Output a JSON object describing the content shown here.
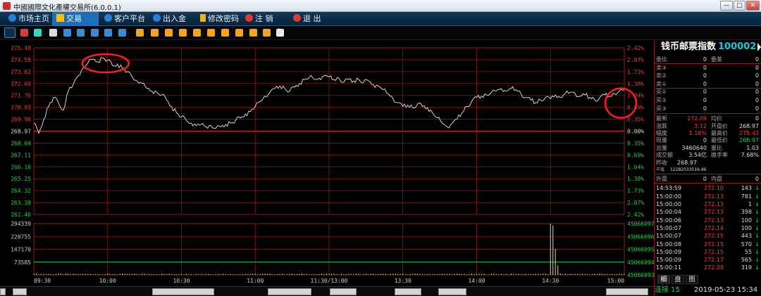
{
  "window": {
    "title": "中國國際文化產權交易所(6.0.0.1)",
    "buttons": [
      "—",
      "□",
      "✕"
    ]
  },
  "menu": [
    {
      "label": "市场主页",
      "icon": "globe-icon",
      "active": false
    },
    {
      "label": "交易",
      "icon": "chart-icon",
      "active": true
    },
    {
      "label": "客户平台",
      "icon": "globe-icon",
      "active": false
    },
    {
      "label": "出入金",
      "icon": "globe-icon",
      "active": false
    },
    {
      "label": "修改密码",
      "icon": "key-icon",
      "active": false
    },
    {
      "label": "注  销",
      "icon": "power-icon",
      "active": false
    },
    {
      "label": "退  出",
      "icon": "power-icon",
      "active": false
    }
  ],
  "toolbar": {
    "buttons": [
      "chart-bars-icon",
      "line-chart-icon",
      "tick-icon",
      "card-icon",
      "day-icon",
      "week-icon",
      "month-icon",
      "season-icon",
      "x-icon",
      "s1-icon",
      "s2-icon",
      "s3-icon",
      "s4-icon",
      "s5-icon",
      "s6-icon",
      "s7-icon",
      "s8-icon",
      "s9-icon",
      "y-icon",
      "pen-icon",
      "settings-icon"
    ]
  },
  "chart_data": {
    "type": "line",
    "price_axis": {
      "left_ticks": [
        "275.48",
        "274.55",
        "273.62",
        "272.69",
        "271.76",
        "270.83",
        "269.90",
        "268.97",
        "268.04",
        "267.11",
        "266.18",
        "265.25",
        "264.32",
        "263.39",
        "262.46"
      ],
      "right_ticks": [
        "2.42%",
        "2.07%",
        "1.73%",
        "1.38%",
        "1.04%",
        "0.69%",
        "0.35%",
        "0.00%",
        "0.35%",
        "0.69%",
        "1.04%",
        "1.38%",
        "1.73%",
        "2.07%",
        "2.42%"
      ],
      "ylim": [
        262.46,
        275.48
      ],
      "base": 268.97
    },
    "volume_axis": {
      "left_ticks": [
        "294339",
        "220755",
        "147170",
        "73585"
      ],
      "right_ticks": [
        "45066097",
        "45066096",
        "45066095",
        "45066094",
        "45066093"
      ],
      "ylim": [
        0,
        294339
      ]
    },
    "x_ticks": [
      "09:30",
      "10:00",
      "10:30",
      "11:00",
      "11:30/13:00",
      "13:30",
      "14:00",
      "14:30",
      "15:00"
    ],
    "price_series": [
      [
        0,
        269.6
      ],
      [
        2,
        268.8
      ],
      [
        4,
        269.9
      ],
      [
        6,
        270.9
      ],
      [
        8,
        271.6
      ],
      [
        10,
        271.2
      ],
      [
        12,
        270.6
      ],
      [
        14,
        272.1
      ],
      [
        16,
        272.6
      ],
      [
        18,
        273.3
      ],
      [
        20,
        273.9
      ],
      [
        22,
        274.3
      ],
      [
        24,
        274.6
      ],
      [
        26,
        274.4
      ],
      [
        28,
        274.7
      ],
      [
        30,
        274.5
      ],
      [
        32,
        274.1
      ],
      [
        34,
        274.2
      ],
      [
        36,
        273.9
      ],
      [
        38,
        273.6
      ],
      [
        40,
        273.2
      ],
      [
        42,
        272.9
      ],
      [
        44,
        272.7
      ],
      [
        46,
        272.3
      ],
      [
        48,
        272.1
      ],
      [
        50,
        272.0
      ],
      [
        52,
        271.8
      ],
      [
        54,
        271.4
      ],
      [
        56,
        270.9
      ],
      [
        58,
        270.4
      ],
      [
        60,
        270.1
      ],
      [
        62,
        269.8
      ],
      [
        64,
        269.6
      ],
      [
        66,
        269.4
      ],
      [
        68,
        269.5
      ],
      [
        70,
        269.3
      ],
      [
        72,
        269.4
      ],
      [
        74,
        269.2
      ],
      [
        76,
        269.3
      ],
      [
        78,
        269.5
      ],
      [
        80,
        269.6
      ],
      [
        82,
        269.8
      ],
      [
        84,
        270.0
      ],
      [
        86,
        270.3
      ],
      [
        88,
        270.5
      ],
      [
        90,
        270.9
      ],
      [
        92,
        271.3
      ],
      [
        94,
        271.7
      ],
      [
        96,
        272.0
      ],
      [
        98,
        272.3
      ],
      [
        100,
        272.5
      ],
      [
        102,
        272.3
      ],
      [
        104,
        272.1
      ],
      [
        106,
        272.4
      ],
      [
        108,
        272.7
      ],
      [
        110,
        273.0
      ],
      [
        112,
        273.2
      ],
      [
        114,
        273.0
      ],
      [
        116,
        273.1
      ],
      [
        118,
        273.3
      ],
      [
        120,
        273.2
      ],
      [
        122,
        273.0
      ],
      [
        124,
        273.1
      ],
      [
        126,
        272.8
      ],
      [
        128,
        273.0
      ],
      [
        130,
        272.9
      ],
      [
        132,
        273.0
      ],
      [
        134,
        272.8
      ],
      [
        136,
        272.9
      ],
      [
        138,
        272.6
      ],
      [
        140,
        272.5
      ],
      [
        142,
        272.2
      ],
      [
        144,
        271.9
      ],
      [
        146,
        271.5
      ],
      [
        148,
        271.2
      ],
      [
        150,
        270.9
      ],
      [
        152,
        271.0
      ],
      [
        154,
        270.8
      ],
      [
        156,
        271.1
      ],
      [
        158,
        270.9
      ],
      [
        160,
        270.8
      ],
      [
        162,
        270.4
      ],
      [
        164,
        270.0
      ],
      [
        166,
        269.6
      ],
      [
        168,
        269.3
      ],
      [
        170,
        269.6
      ],
      [
        172,
        269.9
      ],
      [
        174,
        270.4
      ],
      [
        176,
        270.9
      ],
      [
        178,
        271.3
      ],
      [
        180,
        271.6
      ],
      [
        182,
        271.7
      ],
      [
        184,
        271.8
      ],
      [
        186,
        272.0
      ],
      [
        188,
        272.1
      ],
      [
        190,
        272.3
      ],
      [
        192,
        272.1
      ],
      [
        194,
        272.3
      ],
      [
        196,
        272.2
      ],
      [
        198,
        271.9
      ],
      [
        200,
        271.6
      ],
      [
        202,
        271.4
      ],
      [
        204,
        271.2
      ],
      [
        206,
        271.4
      ],
      [
        208,
        271.6
      ],
      [
        210,
        271.5
      ],
      [
        212,
        271.8
      ],
      [
        214,
        271.6
      ],
      [
        216,
        271.9
      ],
      [
        218,
        272.0
      ],
      [
        220,
        271.9
      ],
      [
        222,
        271.7
      ],
      [
        224,
        271.8
      ],
      [
        226,
        271.6
      ],
      [
        228,
        271.4
      ],
      [
        230,
        271.6
      ],
      [
        232,
        271.8
      ],
      [
        234,
        271.7
      ],
      [
        236,
        271.9
      ],
      [
        238,
        272.1
      ],
      [
        240,
        272.2
      ]
    ],
    "volume_series": [
      [
        0,
        6000
      ],
      [
        20,
        7000
      ],
      [
        40,
        5500
      ],
      [
        60,
        6500
      ],
      [
        80,
        5000
      ],
      [
        100,
        5500
      ],
      [
        120,
        6000
      ],
      [
        140,
        5000
      ],
      [
        160,
        5500
      ],
      [
        180,
        6000
      ],
      [
        200,
        6500
      ],
      [
        210,
        294339
      ],
      [
        211,
        284000
      ],
      [
        212,
        150000
      ],
      [
        213,
        54000
      ],
      [
        214,
        9000
      ],
      [
        220,
        6000
      ],
      [
        240,
        7000
      ]
    ],
    "baseline_volume": 45066094,
    "colors": {
      "price_line": "#e6e6e6",
      "grid": "#8b1a1a",
      "up": "#ff3b3b",
      "down": "#25d04a",
      "volume": "#d9d9a8",
      "annotation": "#ff1c1c"
    },
    "annotations": [
      {
        "shape": "circle",
        "at": [
          28,
          274.6
        ]
      },
      {
        "shape": "circle",
        "at": [
          240,
          271.6
        ]
      }
    ]
  },
  "panel": {
    "name": "钱币邮票指数",
    "code": "100002",
    "order_book": [
      {
        "label": "委比",
        "value": "0",
        "label2": "委差",
        "value2": "0"
      },
      {
        "label": "卖③",
        "value": "0",
        "value2": "0"
      },
      {
        "label": "卖②",
        "value": "0",
        "value2": "0"
      },
      {
        "label": "卖①",
        "value": "0",
        "value2": "0"
      },
      {
        "label": "买①",
        "value": "0",
        "value2": "0"
      },
      {
        "label": "买②",
        "value": "0",
        "value2": "0"
      },
      {
        "label": "买③",
        "value": "0",
        "value2": "0"
      }
    ],
    "quote": [
      {
        "l1": "最新",
        "v1": "272.09",
        "l2": "均价",
        "v2": "0"
      },
      {
        "l1": "涨跌",
        "v1": "3.12",
        "l2": "开盘价",
        "v2": "268.97"
      },
      {
        "l1": "幅度",
        "v1": "1.16%",
        "l2": "最高价",
        "v2": "275.43"
      },
      {
        "l1": "现量",
        "v1": "0",
        "l2": "最低价",
        "v2": "266.97"
      },
      {
        "l1": "总量",
        "v1": "3460640",
        "l2": "量比",
        "v2": "1.03"
      },
      {
        "l1": "成交额",
        "v1": "3.54亿",
        "l2": "换手率",
        "v2": "7.68%"
      },
      {
        "l1": "昨收",
        "v1": "268.97",
        "l2": "",
        "v2": ""
      },
      {
        "l1": "市值",
        "v1": "12282033516.46",
        "l2": "",
        "v2": ""
      }
    ],
    "outer": {
      "l1": "外盘",
      "v1": "0",
      "l2": "内盘",
      "v2": "0"
    },
    "ticks": [
      {
        "t": "14:53:59",
        "p": "272.10",
        "v": "143"
      },
      {
        "t": "15:00:00",
        "p": "272.13",
        "v": "781"
      },
      {
        "t": "15:00:00",
        "p": "272.13",
        "v": "1"
      },
      {
        "t": "15:00:04",
        "p": "272.13",
        "v": "398"
      },
      {
        "t": "15:00:06",
        "p": "272.13",
        "v": "100"
      },
      {
        "t": "15:00:07",
        "p": "272.14",
        "v": "100"
      },
      {
        "t": "15:00:07",
        "p": "272.15",
        "v": "443"
      },
      {
        "t": "15:00:08",
        "p": "272.15",
        "v": "570"
      },
      {
        "t": "15:00:09",
        "p": "272.15",
        "v": "55"
      },
      {
        "t": "15:00:09",
        "p": "272.17",
        "v": "565"
      },
      {
        "t": "15:00:11",
        "p": "272.09",
        "v": "319"
      }
    ],
    "tabs": [
      "细",
      "盘",
      "图"
    ],
    "status": {
      "conn": "连接 15",
      "datetime": "2019-05-23 15:34"
    }
  }
}
